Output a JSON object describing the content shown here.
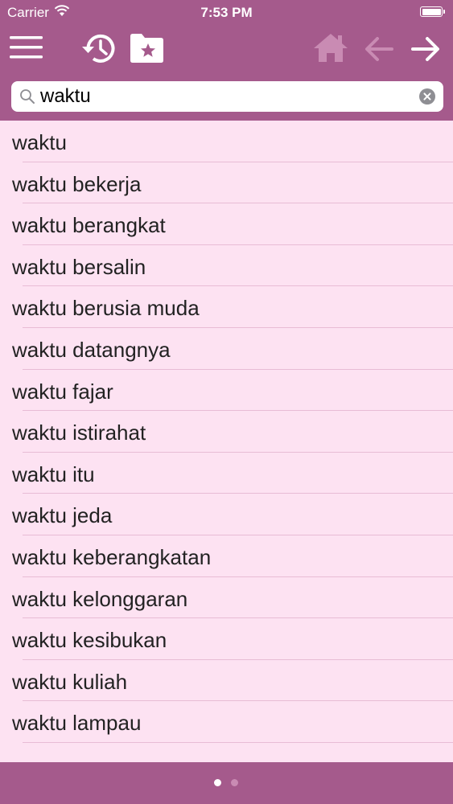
{
  "status_bar": {
    "carrier": "Carrier",
    "time": "7:53 PM"
  },
  "toolbar": {
    "icons": [
      "menu-icon",
      "history-icon",
      "favorites-folder-icon",
      "home-icon",
      "back-arrow-icon",
      "forward-arrow-icon"
    ]
  },
  "search": {
    "value": "waktu"
  },
  "results": [
    "waktu",
    "waktu bekerja",
    "waktu berangkat",
    "waktu bersalin",
    "waktu berusia muda",
    "waktu datangnya",
    "waktu fajar",
    "waktu istirahat",
    "waktu itu",
    "waktu jeda",
    "waktu keberangkatan",
    "waktu kelonggaran",
    "waktu kesibukan",
    "waktu kuliah",
    "waktu lampau"
  ],
  "pager": {
    "pages": 2,
    "current": 1
  },
  "colors": {
    "accent": "#a55a8c",
    "list_background": "#fde2f2",
    "separator": "#e8bcd5"
  }
}
